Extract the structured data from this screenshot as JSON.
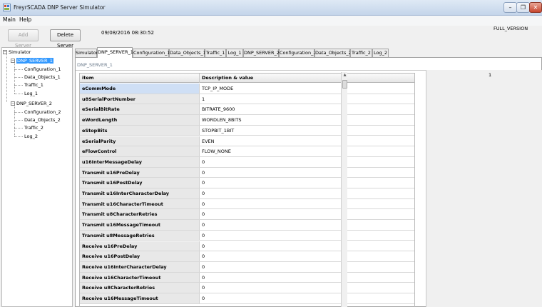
{
  "window": {
    "title": "FreyrSCADA DNP Server Simulator",
    "min_glyph": "–",
    "max_glyph": "❐",
    "close_glyph": "✕"
  },
  "menu": {
    "items": [
      "Main",
      "Help"
    ]
  },
  "toolbar": {
    "add_server": "Add Server",
    "delete_server": "Delete Server",
    "datetime": "09/08/2016 08:30:52",
    "version": "FULL_VERSION"
  },
  "tree": {
    "root": "Simulator",
    "servers": [
      {
        "label": "DNP_SERVER_1",
        "children": [
          "Configuration_1",
          "Data_Objects_1",
          "Traffic_1",
          "Log_1"
        ]
      },
      {
        "label": "DNP_SERVER_2",
        "children": [
          "Configuration_2",
          "Data_Objects_2",
          "Traffic_2",
          "Log_2"
        ]
      }
    ]
  },
  "tabs": [
    "Simulator",
    "DNP_SERVER_1",
    "Configuration_1",
    "Data_Objects_1",
    "Traffic_1",
    "Log_1",
    "DNP_SERVER_2",
    "Configuration_2",
    "Data_Objects_2",
    "Traffic_2",
    "Log_2"
  ],
  "active_tab": "DNP_SERVER_1",
  "panel": {
    "header": "DNP_SERVER_1",
    "columns": {
      "item": "item",
      "value": "Description & value"
    },
    "rows": [
      {
        "item": "eCommMode",
        "value": "TCP_IP_MODE"
      },
      {
        "item": "u8SerialPortNumber",
        "value": "1"
      },
      {
        "item": "eSerialBitRate",
        "value": "BITRATE_9600"
      },
      {
        "item": "eWordLength",
        "value": "WORDLEN_8BITS"
      },
      {
        "item": "eStopBits",
        "value": "STOPBIT_1BIT"
      },
      {
        "item": "eSerialParity",
        "value": "EVEN"
      },
      {
        "item": "eFlowControl",
        "value": "FLOW_NONE"
      },
      {
        "item": "u16InterMessageDelay",
        "value": "0"
      },
      {
        "item": "Transmit u16PreDelay",
        "value": "0"
      },
      {
        "item": "Transmit u16PostDelay",
        "value": "0"
      },
      {
        "item": "Transmit u16InterCharacterDelay",
        "value": "0"
      },
      {
        "item": "Transmit u16CharacterTimeout",
        "value": "0"
      },
      {
        "item": "Transmit u8CharacterRetries",
        "value": "0"
      },
      {
        "item": "Transmit u16MessageTimeout",
        "value": "0"
      },
      {
        "item": "Transmit u8MessageRetries",
        "value": "0"
      },
      {
        "item": "Receive u16PreDelay",
        "value": "0"
      },
      {
        "item": "Receive u16PostDelay",
        "value": "0"
      },
      {
        "item": "Receive u16InterCharacterDelay",
        "value": "0"
      },
      {
        "item": "Receive u16CharacterTimeout",
        "value": "0"
      },
      {
        "item": "Receive u8CharacterRetries",
        "value": "0"
      },
      {
        "item": "Receive u16MessageTimeout",
        "value": "0"
      }
    ],
    "right_value": "1",
    "scroll_up": "▲"
  },
  "colors": {
    "selection": "#3399ff",
    "titlebar": "#c4d5ea",
    "close": "#c7442d"
  }
}
